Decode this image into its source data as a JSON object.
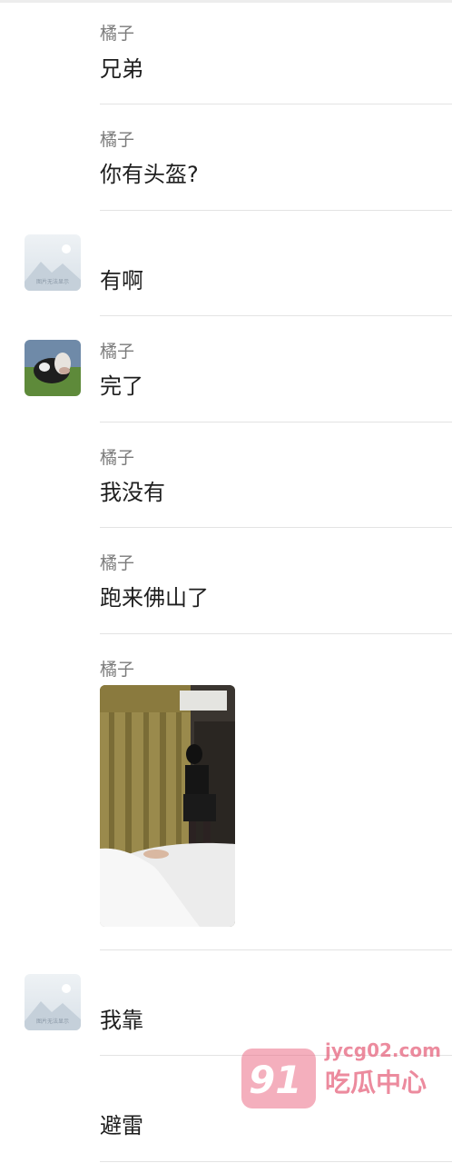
{
  "messages": [
    {
      "sender": "橘子",
      "text": "兄弟"
    },
    {
      "sender": "橘子",
      "text": "你有头盔?"
    },
    {
      "sender": "",
      "text": "有啊",
      "avatar": "placeholder"
    },
    {
      "sender": "橘子",
      "text": "完了",
      "avatar": "cow-photo"
    },
    {
      "sender": "橘子",
      "text": "我没有"
    },
    {
      "sender": "橘子",
      "text": "跑来佛山了"
    },
    {
      "sender": "橘子",
      "image": "bedroom-photo"
    },
    {
      "sender": "",
      "text": "我靠",
      "avatar": "placeholder"
    },
    {
      "sender": "",
      "text": "避雷"
    }
  ],
  "placeholder_caption": "图片无法显示",
  "watermark": {
    "badge": "91",
    "domain": "jycg02.com",
    "name": "吃瓜中心"
  }
}
